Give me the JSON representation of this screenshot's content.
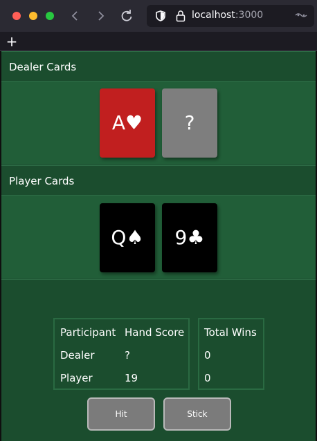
{
  "browser": {
    "url_host": "localhost",
    "url_port": ":3000",
    "new_tab_symbol": "+",
    "icons": [
      "back-icon",
      "forward-icon",
      "reload-icon",
      "shield-icon",
      "lock-icon",
      "reader-view-icon",
      "new-tab-icon"
    ]
  },
  "dealer": {
    "header": "Dealer Cards",
    "cards": [
      {
        "label": "A♥",
        "color": "#c11f1f"
      },
      {
        "label": "?",
        "color": "#7e7e7e"
      }
    ]
  },
  "player": {
    "header": "Player Cards",
    "cards": [
      {
        "label": "Q♠",
        "color": "#000000"
      },
      {
        "label": "9♣",
        "color": "#000000"
      }
    ]
  },
  "scoreboard": {
    "headers": {
      "participant": "Participant",
      "hand_score": "Hand Score",
      "total_wins": "Total Wins"
    },
    "rows": [
      {
        "participant": "Dealer",
        "hand_score": "?",
        "total_wins": "0"
      },
      {
        "participant": "Player",
        "hand_score": "19",
        "total_wins": "0"
      }
    ]
  },
  "actions": {
    "hit_label": "Hit",
    "stick_label": "Stick"
  },
  "colors": {
    "table_green": "#1e5233",
    "header_green": "#1b4d2e",
    "card_red": "#c11f1f",
    "card_hidden": "#7e7e7e",
    "button_gray": "#7b7b7b"
  }
}
